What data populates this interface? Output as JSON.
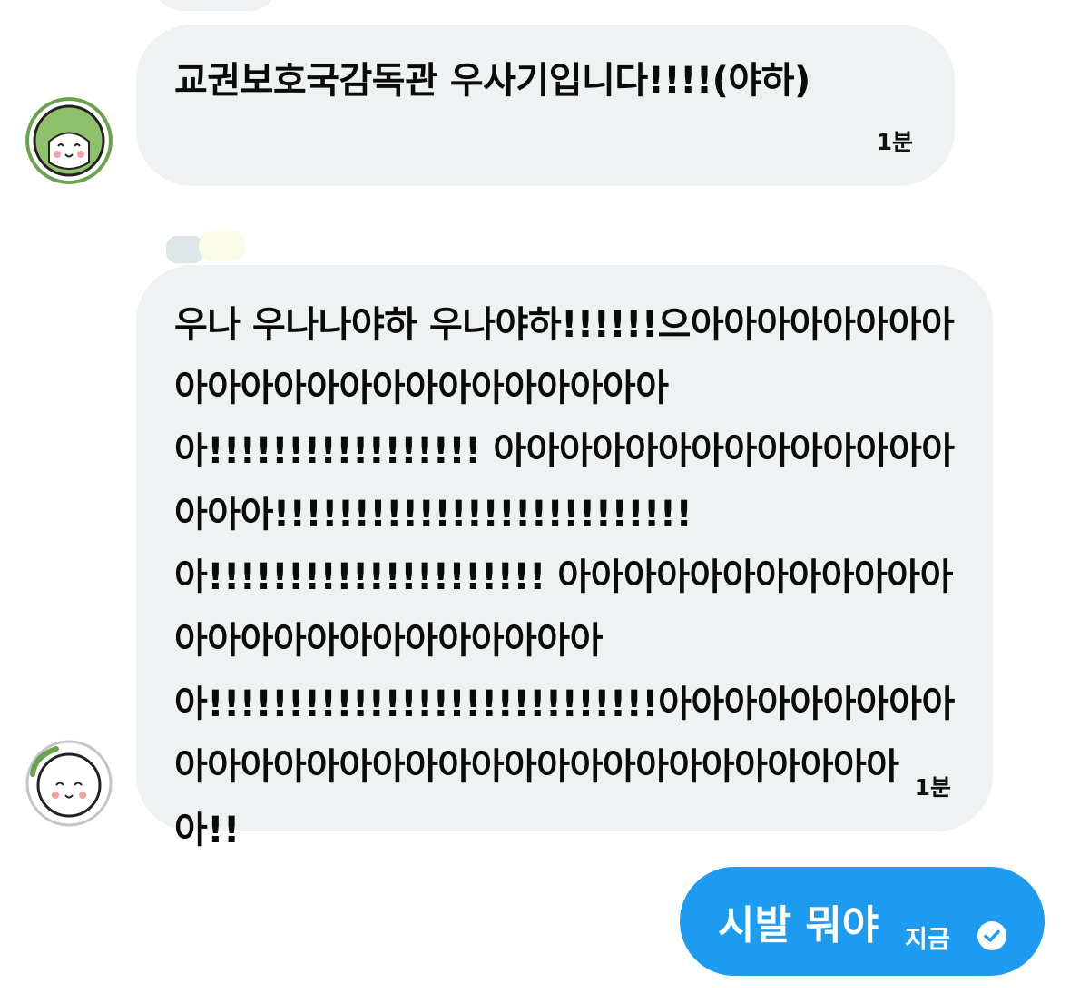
{
  "conversation": {
    "messages": [
      {
        "text": "교권보호국감독관 우사기입니다!!!!(야하)",
        "time": "1분"
      },
      {
        "text": "우나 우나나야하 우나야하!!!!!!으아아아아아아아아아아아아아아아아아아아아아아아아!!!!!!!!!!!!!!!!! 아아아아아아아아아아아아아아아아아!!!!!!!!!!!!!!!!!!!!!!!!!! 아!!!!!!!!!!!!!!!!!!!!! 아아아아아아아아아아아아아아아아아아아아아아아아아아!!!!!!!!!!!!!!!!!!!!!!!!!!!!아아아아아아아아아아아아아아아아아아아아아아아아아아아아아아아아!!",
        "time": "1분"
      },
      {
        "text": "시발 뭐야",
        "time": "지금"
      }
    ]
  },
  "icons": {
    "avatar": "chiikawa-usagi-avatar-icon",
    "sent_status": "seen-check-icon"
  },
  "colors": {
    "received_bubble": "#eef2f3",
    "sent_bubble": "#1d9bf0",
    "avatar_green": "#6aa34d",
    "text": "#0b0b0b",
    "sent_text": "#ffffff"
  }
}
